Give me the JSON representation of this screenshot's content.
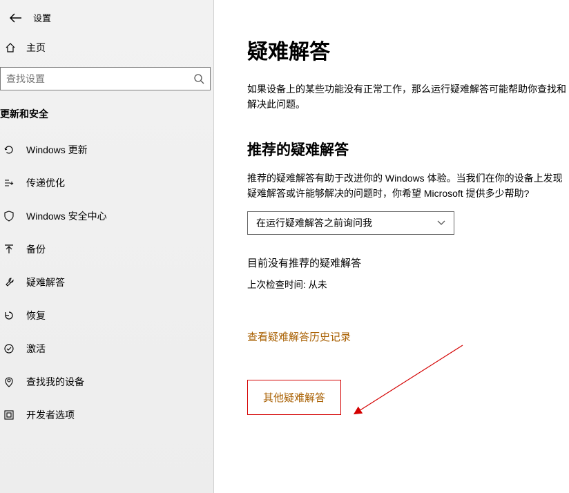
{
  "header": {
    "settings_label": "设置"
  },
  "home": {
    "label": "主页"
  },
  "search": {
    "placeholder": "查找设置"
  },
  "sidebar": {
    "section_title": "更新和安全",
    "items": [
      {
        "label": "Windows 更新"
      },
      {
        "label": "传递优化"
      },
      {
        "label": "Windows 安全中心"
      },
      {
        "label": "备份"
      },
      {
        "label": "疑难解答"
      },
      {
        "label": "恢复"
      },
      {
        "label": "激活"
      },
      {
        "label": "查找我的设备"
      },
      {
        "label": "开发者选项"
      }
    ]
  },
  "main": {
    "title": "疑难解答",
    "intro": "如果设备上的某些功能没有正常工作，那么运行疑难解答可能帮助你查找和解决此问题。",
    "recommended_title": "推荐的疑难解答",
    "recommended_desc": "推荐的疑难解答有助于改进你的 Windows 体验。当我们在你的设备上发现疑难解答或许能够解决的问题时，你希望 Microsoft 提供多少帮助?",
    "dropdown_value": "在运行疑难解答之前询问我",
    "no_recommended": "目前没有推荐的疑难解答",
    "last_check": "上次检查时间: 从未",
    "history_link": "查看疑难解答历史记录",
    "other_link": "其他疑难解答"
  }
}
